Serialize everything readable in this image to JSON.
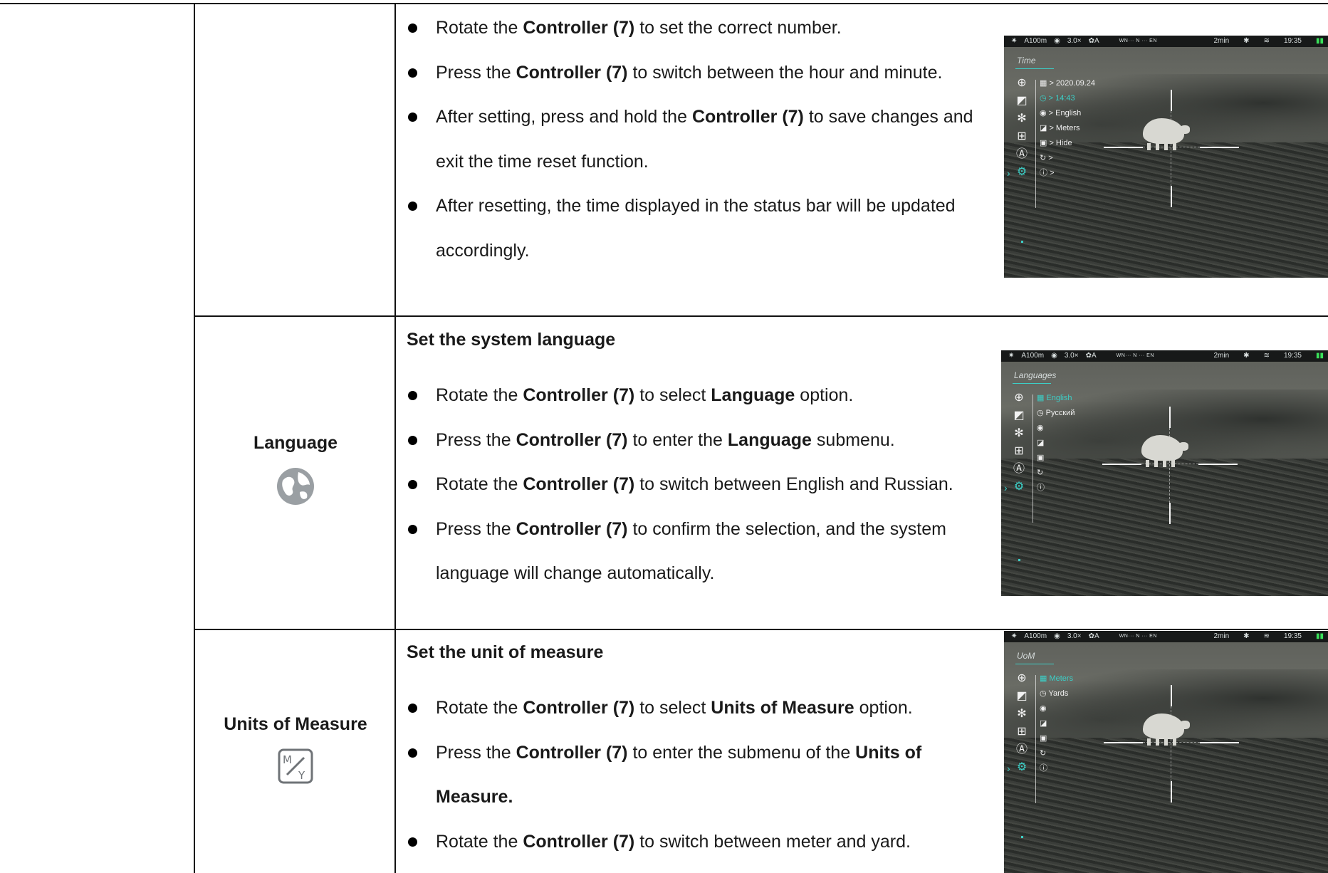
{
  "rows": [
    {
      "id": "time",
      "name": "",
      "heading": "",
      "bullets": [
        [
          {
            "t": "Rotate the "
          },
          {
            "t": "Controller (7)",
            "b": true
          },
          {
            "t": " to set the correct number."
          }
        ],
        [
          {
            "t": "Press the "
          },
          {
            "t": "Controller (7)",
            "b": true
          },
          {
            "t": " to switch between the hour and minute."
          }
        ],
        [
          {
            "t": "After setting, press and hold the "
          },
          {
            "t": "Controller (7)",
            "b": true
          },
          {
            "t": " to save changes and exit the time reset function."
          }
        ],
        [
          {
            "t": "After resetting, the time displayed in the status bar will be updated accordingly."
          }
        ]
      ],
      "screenshot": {
        "title": "Time",
        "selected_menu_index": 6,
        "submenu": [
          {
            "icon": "calendar-icon",
            "glyph": "▦",
            "text": "> 2020.09.24",
            "selected": false
          },
          {
            "icon": "clock-icon",
            "glyph": "◷",
            "text": "> 14:43",
            "selected": true
          },
          {
            "icon": "globe-icon",
            "glyph": "◉",
            "text": "> English",
            "selected": false
          },
          {
            "icon": "units-icon",
            "glyph": "◪",
            "text": "> Meters",
            "selected": false
          },
          {
            "icon": "display-icon",
            "glyph": "▣",
            "text": "> Hide",
            "selected": false
          },
          {
            "icon": "reset-icon",
            "glyph": "↻",
            "text": ">",
            "selected": false
          },
          {
            "icon": "info-icon",
            "glyph": "ⓘ",
            "text": ">",
            "selected": false
          }
        ]
      }
    },
    {
      "id": "language",
      "name": "Language",
      "icon": "globe-icon",
      "heading": "Set the system language",
      "bullets": [
        [
          {
            "t": "Rotate the "
          },
          {
            "t": "Controller (7)",
            "b": true
          },
          {
            "t": " to select "
          },
          {
            "t": "Language",
            "b": true
          },
          {
            "t": " option."
          }
        ],
        [
          {
            "t": "Press the "
          },
          {
            "t": "Controller (7)",
            "b": true
          },
          {
            "t": " to enter the "
          },
          {
            "t": "Language",
            "b": true
          },
          {
            "t": " submenu."
          }
        ],
        [
          {
            "t": "Rotate the "
          },
          {
            "t": "Controller (7)",
            "b": true
          },
          {
            "t": " to switch between English and Russian."
          }
        ],
        [
          {
            "t": "Press the "
          },
          {
            "t": "Controller (7)",
            "b": true
          },
          {
            "t": " to confirm the selection, and the system language will change automatically."
          }
        ]
      ],
      "screenshot": {
        "title": "Languages",
        "selected_menu_index": 6,
        "submenu": [
          {
            "icon": "calendar-icon",
            "glyph": "▦",
            "text": "English",
            "selected": true
          },
          {
            "icon": "clock-icon",
            "glyph": "◷",
            "text": "Русский",
            "selected": false
          },
          {
            "icon": "globe-icon",
            "glyph": "◉",
            "text": "",
            "selected": false
          },
          {
            "icon": "units-icon",
            "glyph": "◪",
            "text": "",
            "selected": false
          },
          {
            "icon": "display-icon",
            "glyph": "▣",
            "text": "",
            "selected": false
          },
          {
            "icon": "reset-icon",
            "glyph": "↻",
            "text": "",
            "selected": false
          },
          {
            "icon": "info-icon",
            "glyph": "ⓘ",
            "text": "",
            "selected": false
          }
        ]
      }
    },
    {
      "id": "units",
      "name": "Units of Measure",
      "icon": "units-of-measure-icon",
      "heading": "Set the unit of measure",
      "bullets": [
        [
          {
            "t": "Rotate the "
          },
          {
            "t": "Controller (7)",
            "b": true
          },
          {
            "t": " to select "
          },
          {
            "t": "Units of Measure",
            "b": true
          },
          {
            "t": " option."
          }
        ],
        [
          {
            "t": "Press the "
          },
          {
            "t": "Controller (7)",
            "b": true
          },
          {
            "t": " to enter the submenu of the "
          },
          {
            "t": "Units of Measure.",
            "b": true
          }
        ],
        [
          {
            "t": "Rotate the "
          },
          {
            "t": "Controller (7)",
            "b": true
          },
          {
            "t": " to switch between meter and yard."
          }
        ]
      ],
      "screenshot": {
        "title": "UoM",
        "selected_menu_index": 6,
        "submenu": [
          {
            "icon": "calendar-icon",
            "glyph": "▦",
            "text": "Meters",
            "selected": true
          },
          {
            "icon": "clock-icon",
            "glyph": "◷",
            "text": "Yards",
            "selected": false
          },
          {
            "icon": "globe-icon",
            "glyph": "◉",
            "text": "",
            "selected": false
          },
          {
            "icon": "units-icon",
            "glyph": "◪",
            "text": "",
            "selected": false
          },
          {
            "icon": "display-icon",
            "glyph": "▣",
            "text": "",
            "selected": false
          },
          {
            "icon": "reset-icon",
            "glyph": "↻",
            "text": "",
            "selected": false
          },
          {
            "icon": "info-icon",
            "glyph": "ⓘ",
            "text": "",
            "selected": false
          }
        ]
      }
    }
  ],
  "status_bar": {
    "range": "A100m",
    "zoom": "3.0×",
    "mode": "✿A",
    "compass": "WN··· N ··· EN",
    "timer": "2min",
    "time": "19:35",
    "battery_color": "#39e05a"
  },
  "main_menu_icons": [
    "crosshair-icon",
    "image-icon",
    "color-mode-icon",
    "add-icon",
    "navigation-icon",
    "settings-icon"
  ],
  "accent_color": "#3ccfc7"
}
